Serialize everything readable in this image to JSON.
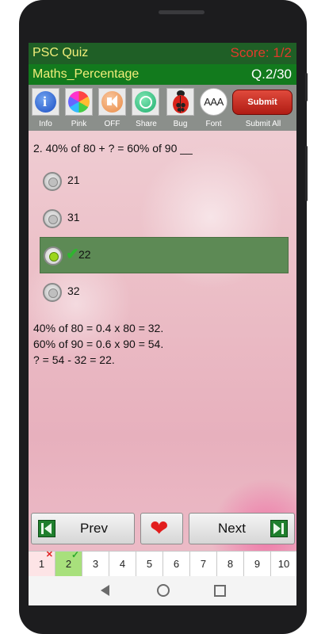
{
  "header": {
    "app_title": "PSC Quiz",
    "score": "Score: 1/2",
    "subject": "Maths_Percentage",
    "question_number": "Q.2/30"
  },
  "toolbar": [
    {
      "label": "Info",
      "icon": "info-icon"
    },
    {
      "label": "Pink",
      "icon": "color-palette-icon"
    },
    {
      "label": "OFF",
      "icon": "speaker-icon"
    },
    {
      "label": "Share",
      "icon": "whatsapp-icon"
    },
    {
      "label": "Bug",
      "icon": "ladybug-icon"
    },
    {
      "label": "Font",
      "icon": "font-size-icon",
      "glyph": "AAA"
    },
    {
      "label": "Submit All",
      "button": "Submit"
    }
  ],
  "question": {
    "text": "2. 40% of 80 + ? = 60% of 90 __"
  },
  "options": [
    {
      "text": "21",
      "selected": false
    },
    {
      "text": "31",
      "selected": false
    },
    {
      "text": "22",
      "selected": true,
      "correct": true
    },
    {
      "text": "32",
      "selected": false
    }
  ],
  "explanation": [
    "40% of 80 = 0.4 x 80 = 32.",
    "60% of 90 = 0.6 x 90 = 54.",
    "? = 54 - 32 = 22."
  ],
  "nav": {
    "prev": "Prev",
    "next": "Next"
  },
  "pages": [
    {
      "n": "1",
      "status": "wrong"
    },
    {
      "n": "2",
      "status": "right"
    },
    {
      "n": "3"
    },
    {
      "n": "4"
    },
    {
      "n": "5"
    },
    {
      "n": "6"
    },
    {
      "n": "7"
    },
    {
      "n": "8"
    },
    {
      "n": "9"
    },
    {
      "n": "10"
    }
  ],
  "colors": {
    "title_bar": "#1f5f26",
    "sub_bar": "#127a1d",
    "title_text": "#f2ee7a",
    "score_text": "#e03b2b",
    "selected_option": "#5d8a55"
  }
}
